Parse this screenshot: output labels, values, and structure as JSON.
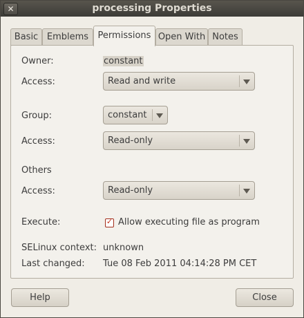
{
  "window": {
    "title": "processing Properties",
    "close_glyph": "✕"
  },
  "tabs": [
    {
      "label": "Basic"
    },
    {
      "label": "Emblems"
    },
    {
      "label": "Permissions",
      "active": true
    },
    {
      "label": "Open With"
    },
    {
      "label": "Notes"
    }
  ],
  "permissions": {
    "owner_label": "Owner:",
    "owner_value": "constant",
    "owner_access_label": "Access:",
    "owner_access_value": "Read and write",
    "group_label": "Group:",
    "group_value": "constant",
    "group_access_label": "Access:",
    "group_access_value": "Read-only",
    "others_label": "Others",
    "others_access_label": "Access:",
    "others_access_value": "Read-only",
    "execute_label": "Execute:",
    "execute_checkbox_label": "Allow executing file as program",
    "execute_checked": true,
    "selinux_label": "SELinux context:",
    "selinux_value": "unknown",
    "last_changed_label": "Last changed:",
    "last_changed_value": "Tue 08 Feb 2011 04:14:28 PM CET"
  },
  "buttons": {
    "help": "Help",
    "close": "Close"
  },
  "icons": {
    "dropdown": "triangle-down-icon",
    "check": "checkmark-icon",
    "close": "close-icon"
  },
  "colors": {
    "titlebar": "#3c3b37",
    "checkbox_accent": "#c1311b",
    "window_bg": "#f0ede6"
  }
}
